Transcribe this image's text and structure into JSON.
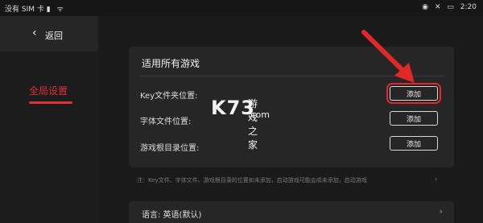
{
  "status_bar": {
    "left_text": "没有 SIM 卡",
    "time": "2:20"
  },
  "sidebar": {
    "back_label": "返回",
    "items": [
      {
        "label": "全局设置",
        "selected": true
      }
    ]
  },
  "panel": {
    "title": "适用所有游戏",
    "rows": [
      {
        "label": "Key文件夹位置:",
        "button_label": "添加"
      },
      {
        "label": "字体文件位置:",
        "button_label": "添加"
      },
      {
        "label": "游戏根目录位置:",
        "button_label": "添加"
      }
    ]
  },
  "note": "注：Key文件、字体文件、游戏根目录的位置如未添加，启动游戏可能会成未添加，启动游戏",
  "language": {
    "label": "语言: 英语(默认)"
  },
  "watermark": {
    "brand": "K73",
    "sub": "游戏之家",
    "domain": ".com"
  },
  "colors": {
    "accent": "#e0323a",
    "annotation": "#e02828",
    "background": "#1a1a1a",
    "card": "#262626"
  }
}
